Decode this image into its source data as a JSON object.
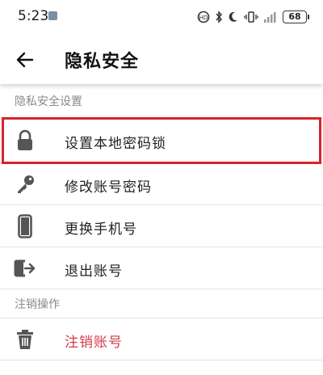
{
  "status_bar": {
    "time": "5:23",
    "battery": "68",
    "icons": [
      "app-notification-icon",
      "vowifi-icon",
      "bluetooth-icon",
      "do-not-disturb-icon",
      "vibrate-icon",
      "signal-icon",
      "battery-icon"
    ]
  },
  "app_bar": {
    "back_icon": "arrow-left-icon",
    "title": "隐私安全"
  },
  "sections": [
    {
      "header": "隐私安全设置",
      "items": [
        {
          "label": "设置本地密码锁",
          "icon": "lock-icon"
        },
        {
          "label": "修改账号密码",
          "icon": "key-icon"
        },
        {
          "label": "更换手机号",
          "icon": "phone-icon"
        },
        {
          "label": "退出账号",
          "icon": "logout-icon"
        }
      ]
    },
    {
      "header": "注销操作",
      "items": [
        {
          "label": "注销账号",
          "icon": "trash-icon"
        }
      ]
    }
  ],
  "colors": {
    "highlight_border": "#d8232a",
    "danger_text": "#d33a4a",
    "icon_gray": "#555555",
    "section_header_text": "#8a8a8a"
  }
}
